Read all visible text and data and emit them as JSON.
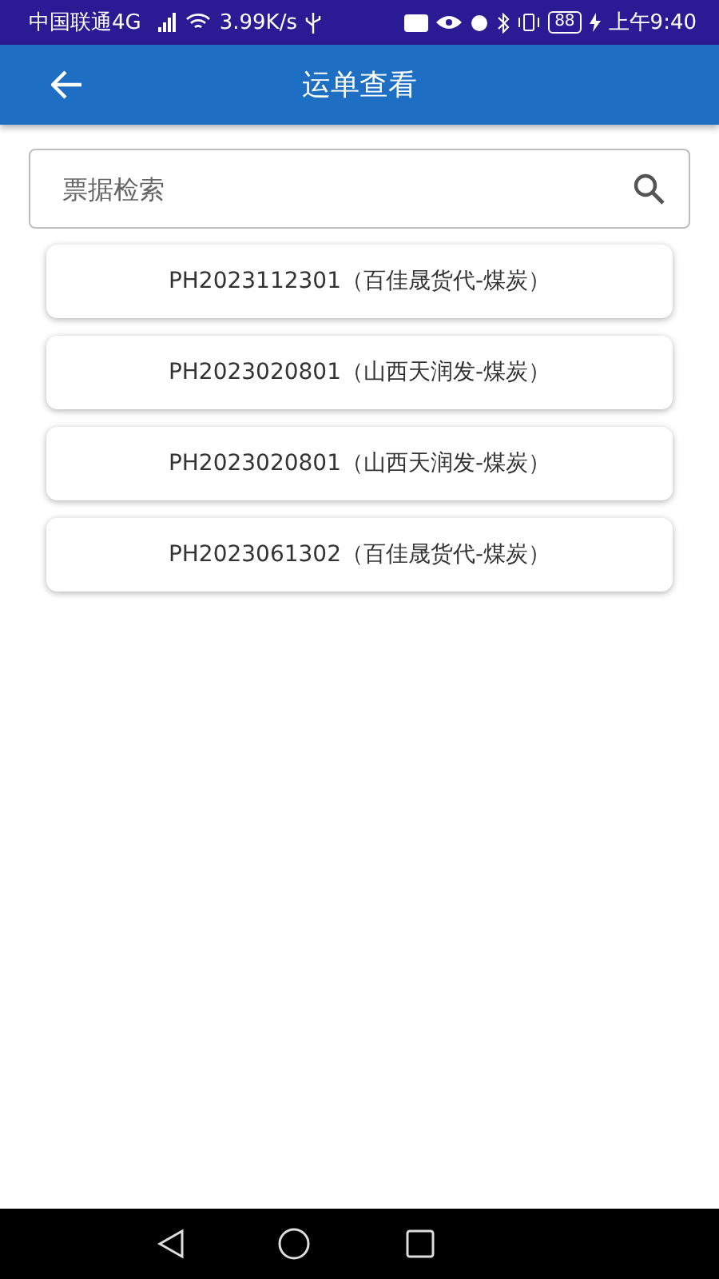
{
  "status_bar": {
    "carrier": "中国联通4G",
    "speed": "3.99K/s",
    "battery": "88",
    "time": "上午9:40"
  },
  "app_bar": {
    "title": "运单查看"
  },
  "search": {
    "placeholder": "票据检索"
  },
  "waybills": [
    {
      "label": "PH2023112301（百佳晟货代-煤炭）"
    },
    {
      "label": "PH2023020801（山西天润发-煤炭）"
    },
    {
      "label": "PH2023020801（山西天润发-煤炭）"
    },
    {
      "label": "PH2023061302（百佳晟货代-煤炭）"
    }
  ]
}
